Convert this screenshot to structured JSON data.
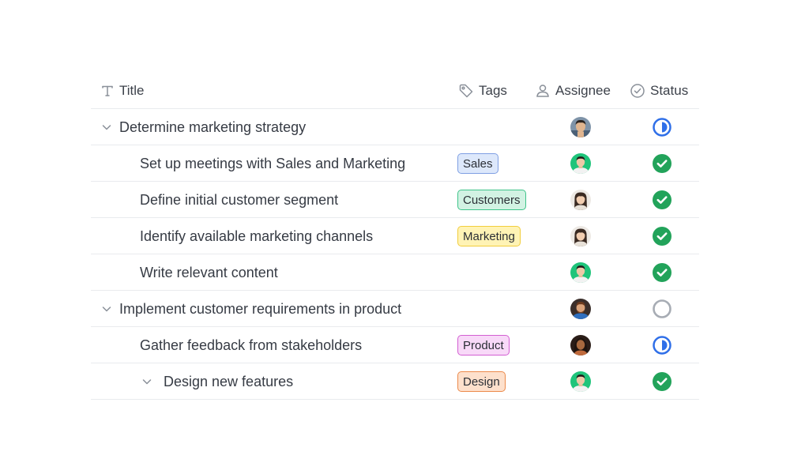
{
  "header": {
    "title": "Title",
    "tags": "Tags",
    "assignee": "Assignee",
    "status": "Status"
  },
  "rows": [
    {
      "title": "Determine marketing strategy",
      "tag": "",
      "avatar": "avatar-man-1",
      "status": "in-progress"
    },
    {
      "title": "Set up meetings with Sales and Marketing",
      "tag": "Sales",
      "avatar": "avatar-man-2",
      "status": "done"
    },
    {
      "title": "Define initial customer segment",
      "tag": "Customers",
      "avatar": "avatar-woman-1",
      "status": "done"
    },
    {
      "title": "Identify available marketing channels",
      "tag": "Marketing",
      "avatar": "avatar-woman-1",
      "status": "done"
    },
    {
      "title": "Write relevant content",
      "tag": "",
      "avatar": "avatar-man-2",
      "status": "done"
    },
    {
      "title": "Implement customer requirements in product",
      "tag": "",
      "avatar": "avatar-man-3",
      "status": "todo"
    },
    {
      "title": "Gather feedback from stakeholders",
      "tag": "Product",
      "avatar": "avatar-woman-2",
      "status": "in-progress"
    },
    {
      "title": "Design new features",
      "tag": "Design",
      "avatar": "avatar-man-2",
      "status": "done"
    }
  ],
  "colors": {
    "status_done": "#22a35a",
    "status_in_progress": "#2f6fe8",
    "status_todo": "#a7acb4",
    "tag_sales": "#dde8fb",
    "tag_customers": "#d2f2e3",
    "tag_marketing": "#fff3b5",
    "tag_product": "#f8d9f8",
    "tag_design": "#fde0cc"
  },
  "icons": {
    "title": "text-icon",
    "tags": "tag-icon",
    "assignee": "person-icon",
    "status": "check-circle-icon",
    "expand": "chevron-down-icon"
  }
}
